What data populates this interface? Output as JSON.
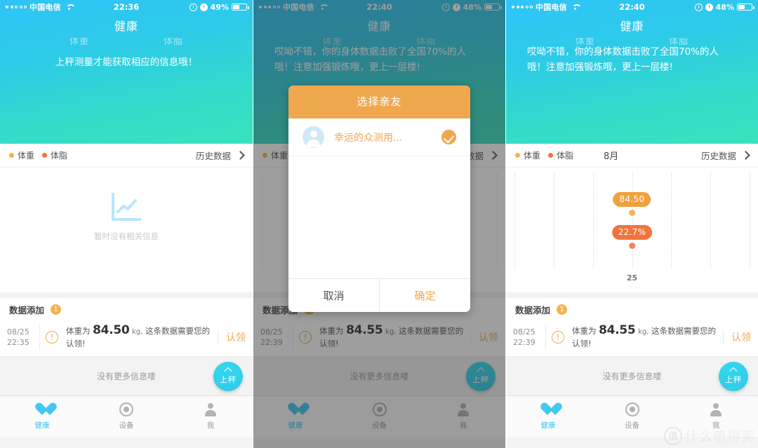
{
  "app": {
    "title": "健康"
  },
  "screens": [
    {
      "id": "screen-empty",
      "statusbar": {
        "carrier": "中国电信",
        "time": "22:36",
        "battery": "49%",
        "signal_filled": 2,
        "signal_total": 5
      },
      "hero": {
        "metric_left": "体重",
        "metric_right": "体脂",
        "message": "上秤测量才能获取相应的信息哦！"
      },
      "chart": {
        "legend": [
          {
            "label": "体重",
            "color": "#f5b44d"
          },
          {
            "label": "体脂",
            "color": "#f2743c"
          }
        ],
        "month": "",
        "history_label": "历史数据",
        "empty_text": "暂时没有相关信息"
      },
      "data_section": {
        "title": "数据添加",
        "count": "1",
        "row": {
          "date": "08/25",
          "time": "22:35",
          "prefix": "体重为",
          "value": "84.50",
          "unit": "kg,",
          "suffix": "这条数据需要您的认领!",
          "action": "认领"
        }
      },
      "footer": {
        "no_more": "没有更多信息喽",
        "fab_label": "上秤"
      },
      "tabs": [
        {
          "label": "健康",
          "icon": "heart-icon",
          "active": true
        },
        {
          "label": "设备",
          "icon": "device-icon",
          "active": false
        },
        {
          "label": "我",
          "icon": "person-icon",
          "active": false
        }
      ]
    },
    {
      "id": "screen-dialog",
      "statusbar": {
        "carrier": "中国电信",
        "time": "22:40",
        "battery": "48%",
        "signal_filled": 3,
        "signal_total": 5
      },
      "hero": {
        "metric_left": "体重",
        "metric_right": "体脂",
        "message_line1": "哎呦不错，你的身体数据击败了全国70%的人",
        "message_line2": "哦！注意加强锻炼哦，更上一层楼!"
      },
      "chart": {
        "legend": [
          {
            "label": "体重",
            "color": "#f5b44d"
          },
          {
            "label": "体脂",
            "color": "#f2743c"
          }
        ],
        "month": "8月",
        "history_label": "历史数据"
      },
      "modal": {
        "title": "选择亲友",
        "friend_name": "幸运的众测用...",
        "cancel_label": "取消",
        "confirm_label": "确定"
      },
      "data_section": {
        "title": "数据添加",
        "count": "1",
        "row": {
          "date": "08/25",
          "time": "22:39",
          "prefix": "体重为",
          "value": "84.55",
          "unit": "kg,",
          "suffix": "这条数据需要您的认领!",
          "action": "认领"
        }
      },
      "footer": {
        "no_more": "没有更多信息喽",
        "fab_label": "上秤"
      },
      "tabs": [
        {
          "label": "健康",
          "icon": "heart-icon",
          "active": true
        },
        {
          "label": "设备",
          "icon": "device-icon",
          "active": false
        },
        {
          "label": "我",
          "icon": "person-icon",
          "active": false
        }
      ]
    },
    {
      "id": "screen-chart",
      "statusbar": {
        "carrier": "中国电信",
        "time": "22:40",
        "battery": "48%",
        "signal_filled": 3,
        "signal_total": 5
      },
      "hero": {
        "metric_left": "体重",
        "metric_right": "体脂",
        "message_line1": "哎呦不错，你的身体数据击败了全国70%的人",
        "message_line2": "哦！注意加强锻炼哦，更上一层楼!"
      },
      "chart": {
        "legend": [
          {
            "label": "体重",
            "color": "#f5b44d"
          },
          {
            "label": "体脂",
            "color": "#f2743c"
          }
        ],
        "month": "8月",
        "history_label": "历史数据"
      },
      "data_section": {
        "title": "数据添加",
        "count": "1",
        "row": {
          "date": "08/25",
          "time": "22:39",
          "prefix": "体重为",
          "value": "84.55",
          "unit": "kg,",
          "suffix": "这条数据需要您的认领!",
          "action": "认领"
        }
      },
      "footer": {
        "no_more": "没有更多信息喽",
        "fab_label": "上秤"
      },
      "tabs": [
        {
          "label": "健康",
          "icon": "heart-icon",
          "active": true
        },
        {
          "label": "设备",
          "icon": "device-icon",
          "active": false
        },
        {
          "label": "我",
          "icon": "person-icon",
          "active": false
        }
      ],
      "watermark": {
        "mark": "值",
        "text": "什么值得买"
      }
    }
  ],
  "chart_data": {
    "type": "scatter",
    "title": "8月",
    "xlabel": "",
    "ylabel": "",
    "x": [
      "25"
    ],
    "gridline_count": 7,
    "series": [
      {
        "name": "体重",
        "color": "#f5b44d",
        "values": [
          84.5
        ],
        "label": "84.50",
        "unit": "kg"
      },
      {
        "name": "体脂",
        "color": "#f4835a",
        "values": [
          22.7
        ],
        "label": "22.7%",
        "unit": "%"
      }
    ],
    "legend_position": "top-left",
    "grid": true
  },
  "colors": {
    "accent_blue": "#41c9ef",
    "hero_top": "#2ec4f7",
    "hero_bottom": "#37e2bd",
    "orange": "#f0a84e",
    "weight": "#f5b44d",
    "fat": "#f2743c"
  }
}
